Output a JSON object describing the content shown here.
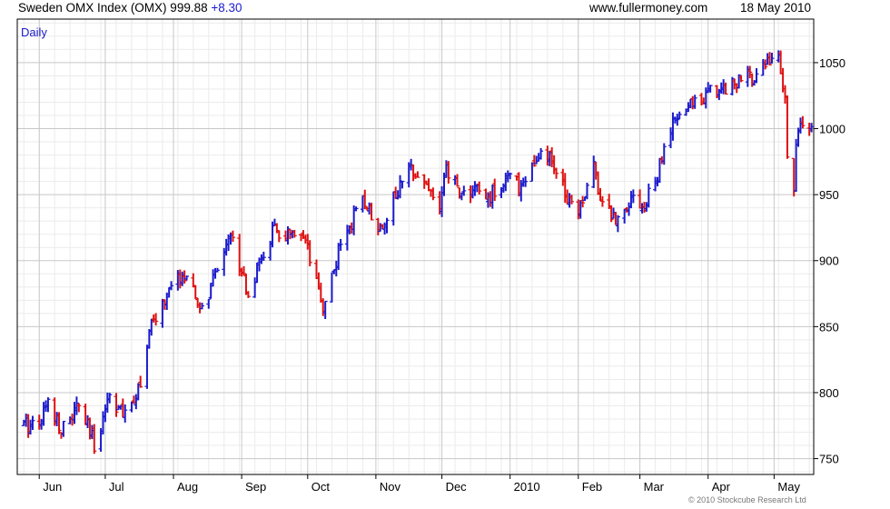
{
  "header": {
    "title": "Sweden OMX Index (OMX) 999.88",
    "change": "+8.30",
    "website": "www.fullermoney.com",
    "date": "18 May 2010"
  },
  "footer": {
    "copyright": "© 2010 Stockcube Research Ltd"
  },
  "chart_data": {
    "type": "ohlc",
    "interval_label": "Daily",
    "ylim": [
      738,
      1083
    ],
    "y_ticks": [
      750,
      800,
      850,
      900,
      950,
      1000,
      1050
    ],
    "y_tick_labels": [
      "750",
      "800",
      "850",
      "900",
      "950",
      "1000",
      "1050"
    ],
    "x_tick_labels": [
      "Jun",
      "Jul",
      "Aug",
      "Sep",
      "Oct",
      "Nov",
      "Dec",
      "2010",
      "Feb",
      "Mar",
      "Apr",
      "May"
    ],
    "x_tick_dates": [
      "2009-06-01",
      "2009-07-01",
      "2009-08-01",
      "2009-09-01",
      "2009-10-01",
      "2009-11-01",
      "2009-12-01",
      "2010-01-01",
      "2010-02-01",
      "2010-03-01",
      "2010-04-01",
      "2010-05-01"
    ],
    "x_range": [
      "2009-05-22",
      "2010-05-19"
    ],
    "up_color": "#1a1acc",
    "down_color": "#dd1111",
    "close_path": [
      [
        "2009-05-25",
        775
      ],
      [
        "2009-06-01",
        780
      ],
      [
        "2009-06-05",
        792
      ],
      [
        "2009-06-12",
        772
      ],
      [
        "2009-06-19",
        790
      ],
      [
        "2009-06-26",
        760
      ],
      [
        "2009-07-03",
        800
      ],
      [
        "2009-07-10",
        780
      ],
      [
        "2009-07-17",
        810
      ],
      [
        "2009-07-22",
        850
      ],
      [
        "2009-07-28",
        870
      ],
      [
        "2009-08-05",
        890
      ],
      [
        "2009-08-11",
        870
      ],
      [
        "2009-08-14",
        862
      ],
      [
        "2009-08-20",
        888
      ],
      [
        "2009-08-26",
        922
      ],
      [
        "2009-09-01",
        895
      ],
      [
        "2009-09-04",
        875
      ],
      [
        "2009-09-10",
        900
      ],
      [
        "2009-09-15",
        922
      ],
      [
        "2009-09-23",
        918
      ],
      [
        "2009-09-30",
        912
      ],
      [
        "2009-10-05",
        880
      ],
      [
        "2009-10-08",
        865
      ],
      [
        "2009-10-13",
        895
      ],
      [
        "2009-10-19",
        925
      ],
      [
        "2009-10-27",
        945
      ],
      [
        "2009-11-03",
        925
      ],
      [
        "2009-11-10",
        950
      ],
      [
        "2009-11-18",
        972
      ],
      [
        "2009-11-25",
        955
      ],
      [
        "2009-11-30",
        940
      ],
      [
        "2009-12-03",
        968
      ],
      [
        "2009-12-10",
        950
      ],
      [
        "2009-12-16",
        955
      ],
      [
        "2009-12-21",
        945
      ],
      [
        "2009-12-30",
        963
      ],
      [
        "2010-01-05",
        957
      ],
      [
        "2010-01-12",
        973
      ],
      [
        "2010-01-18",
        980
      ],
      [
        "2010-01-25",
        955
      ],
      [
        "2010-02-01",
        940
      ],
      [
        "2010-02-08",
        970
      ],
      [
        "2010-02-12",
        945
      ],
      [
        "2010-02-18",
        930
      ],
      [
        "2010-02-25",
        950
      ],
      [
        "2010-03-03",
        940
      ],
      [
        "2010-03-09",
        965
      ],
      [
        "2010-03-15",
        1000
      ],
      [
        "2010-03-22",
        1015
      ],
      [
        "2010-03-29",
        1025
      ],
      [
        "2010-04-06",
        1030
      ],
      [
        "2010-04-12",
        1035
      ],
      [
        "2010-04-19",
        1038
      ],
      [
        "2010-04-26",
        1048
      ],
      [
        "2010-04-30",
        1055
      ],
      [
        "2010-05-03",
        1050
      ],
      [
        "2010-05-06",
        1020
      ],
      [
        "2010-05-07",
        985
      ],
      [
        "2010-05-10",
        950
      ],
      [
        "2010-05-11",
        990
      ],
      [
        "2010-05-14",
        1005
      ],
      [
        "2010-05-18",
        999.88
      ]
    ]
  }
}
